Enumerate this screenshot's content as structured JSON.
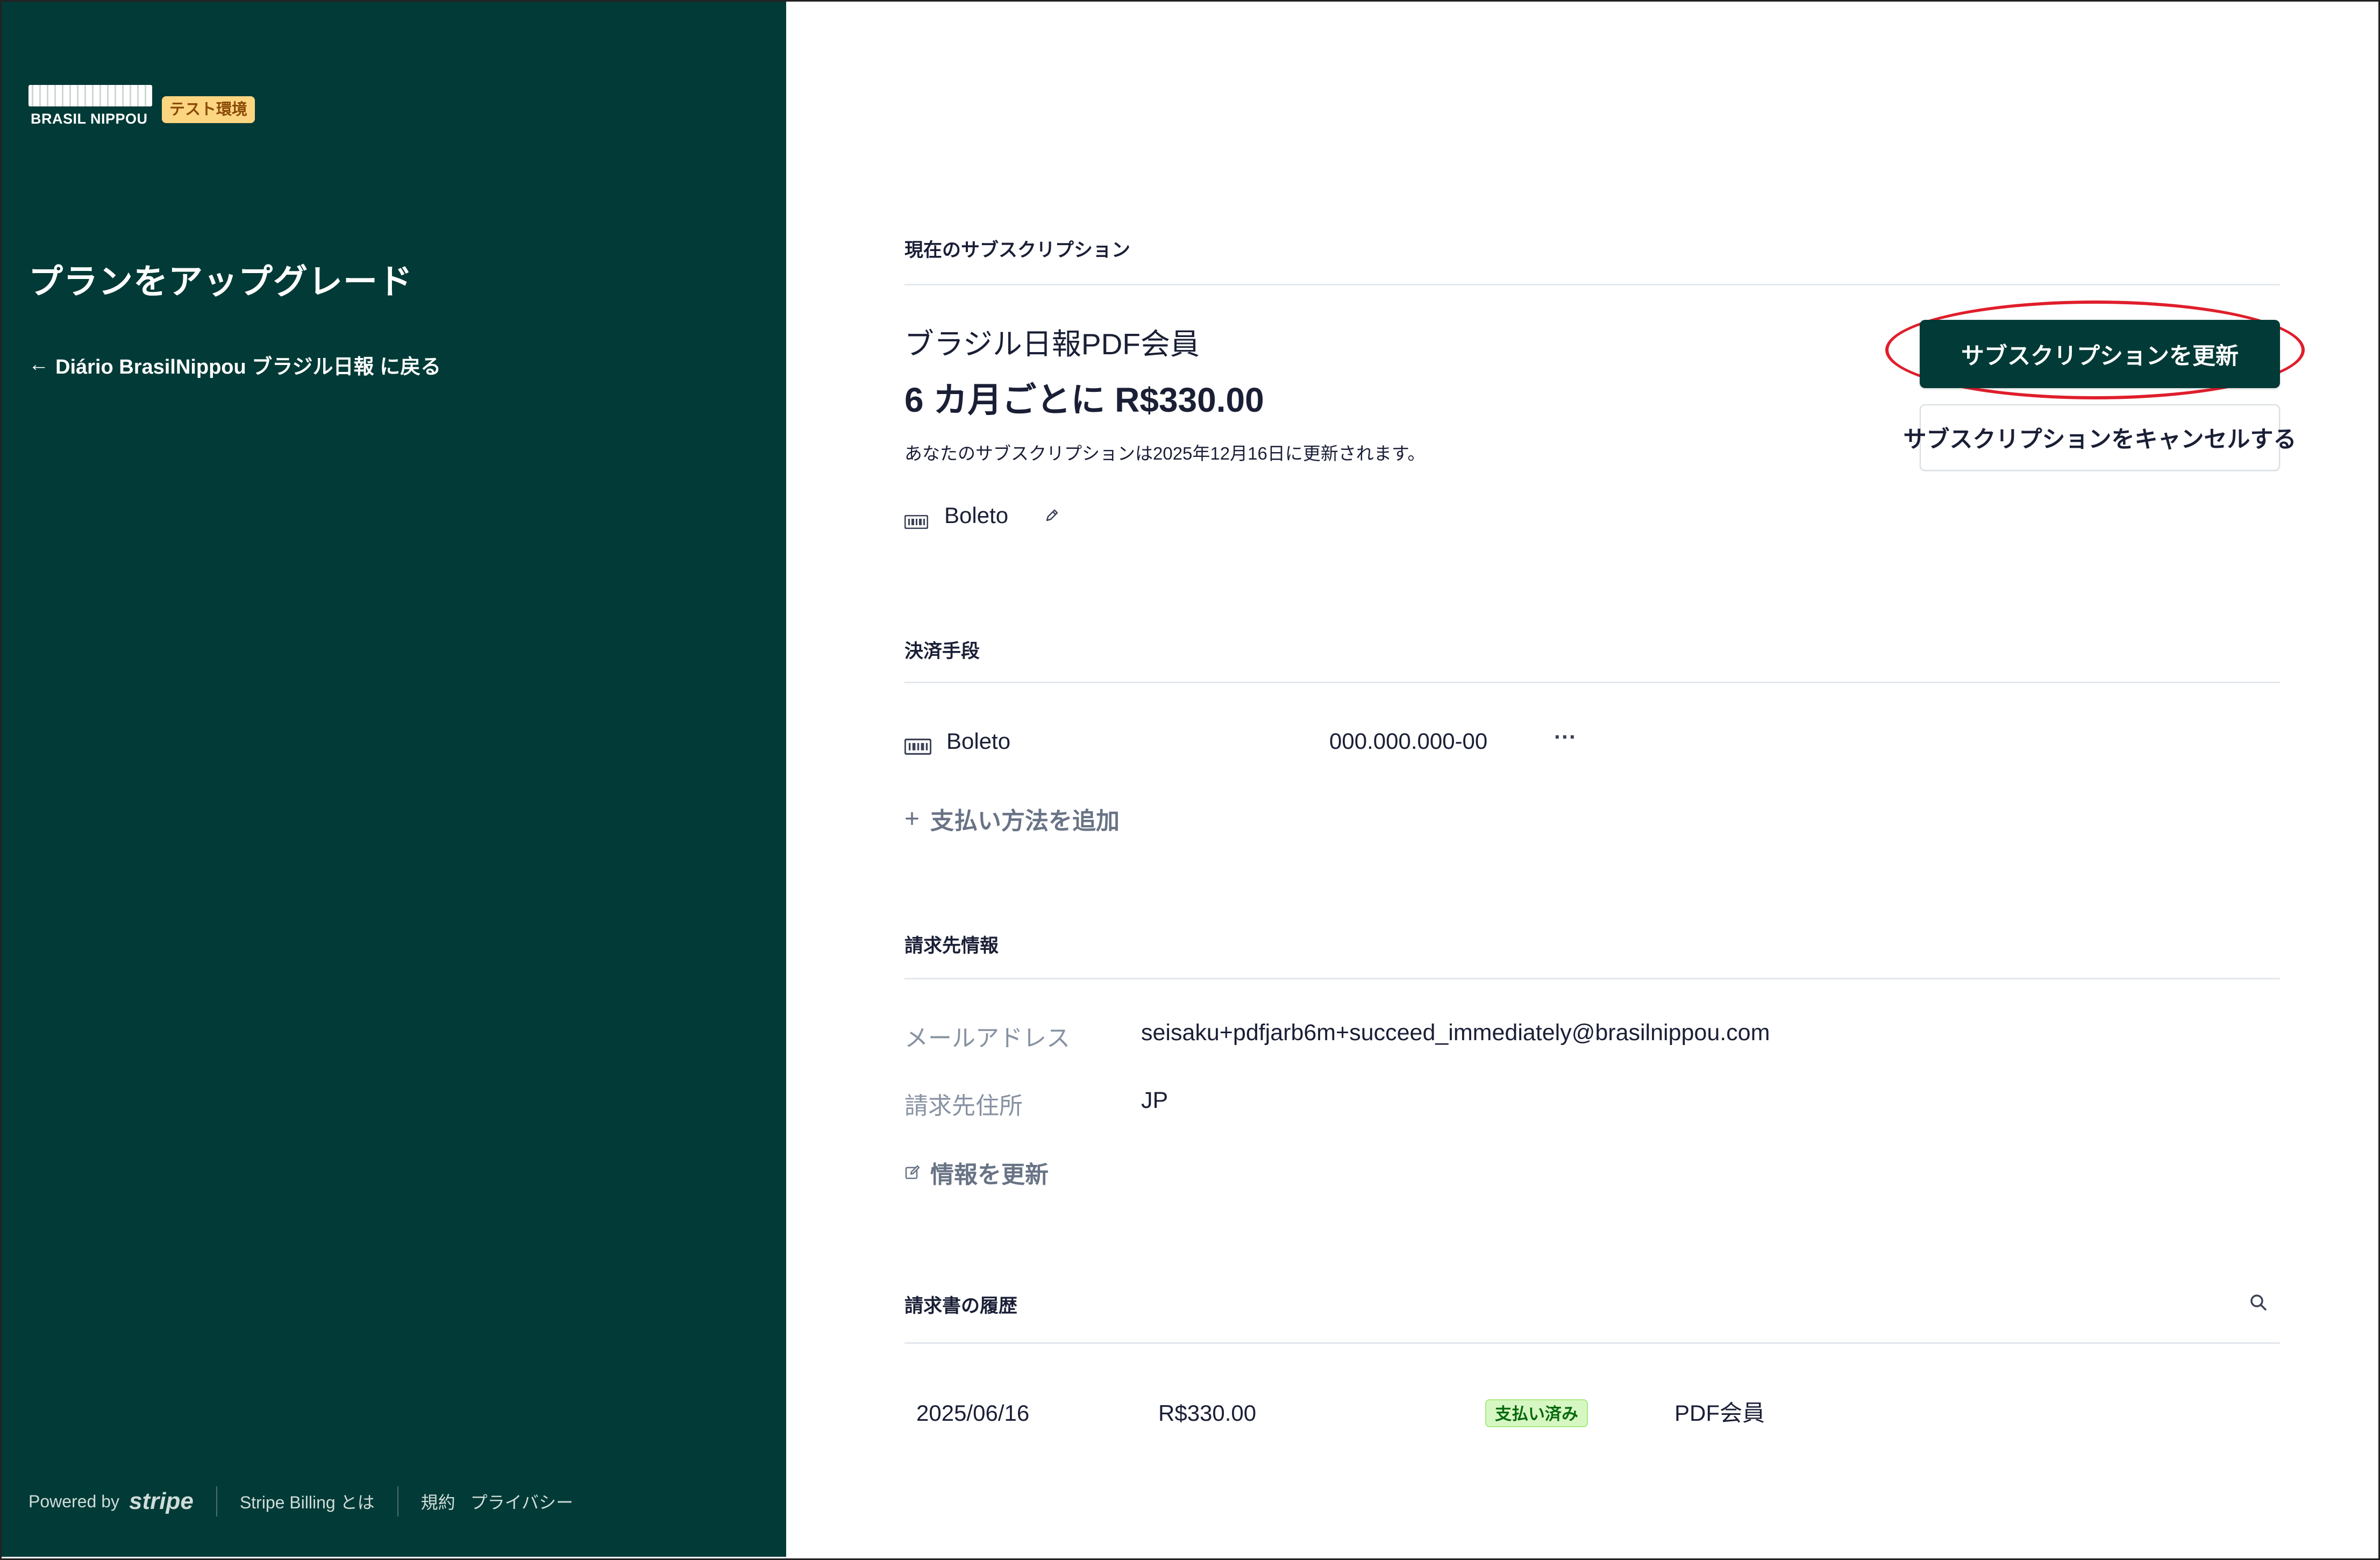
{
  "sidebar": {
    "logo_text": "BRASIL NIPPOU",
    "logo_title": "ブラジル日報",
    "test_badge": "テスト環境",
    "title": "プランをアップグレード",
    "back_arrow": "←",
    "back_link": "Diário BrasilNippou ブラジル日報 に戻る",
    "footer": {
      "powered_by": "Powered by",
      "stripe": "stripe",
      "billing_link": "Stripe Billing とは",
      "terms": "規約",
      "privacy": "プライバシー"
    }
  },
  "current_subscription": {
    "section_label": "現在のサブスクリプション",
    "plan_name": "ブラジル日報PDF会員",
    "price": "6 カ月ごとに R$330.00",
    "renew_note": "あなたのサブスクリプションは2025年12月16日に更新されます。",
    "payment_method": "Boleto",
    "update_button": "サブスクリプションを更新",
    "cancel_button": "サブスクリプションをキャンセルする"
  },
  "payment_methods": {
    "section_label": "決済手段",
    "items": [
      {
        "type": "Boleto",
        "number": "000.000.000-00",
        "menu": "···"
      }
    ],
    "add_icon": "+",
    "add_label": "支払い方法を追加"
  },
  "billing_info": {
    "section_label": "請求先情報",
    "email_label": "メールアドレス",
    "email_value": "seisaku+pdfjarb6m+succeed_immediately@brasilnippou.com",
    "address_label": "請求先住所",
    "address_value": "JP",
    "update_label": "情報を更新"
  },
  "invoice_history": {
    "section_label": "請求書の履歴",
    "rows": [
      {
        "date": "2025/06/16",
        "amount": "R$330.00",
        "status": "支払い済み",
        "description": "PDF会員"
      }
    ]
  },
  "colors": {
    "sidebar_bg": "#013a36",
    "primary_button": "#013a36",
    "highlight_ring": "#e01e2b",
    "paid_badge_bg": "#d7f7c2",
    "test_badge_bg": "#fcd581"
  },
  "icons": [
    "card-icon",
    "pencil-icon",
    "plus-icon",
    "edit-icon",
    "search-icon",
    "back-arrow-icon",
    "more-icon"
  ]
}
